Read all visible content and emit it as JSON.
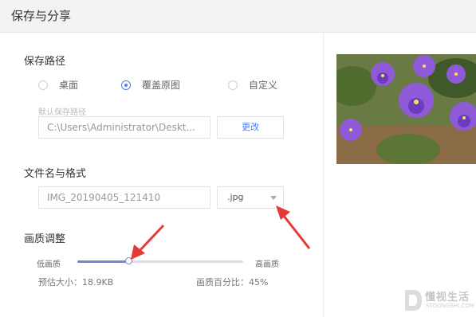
{
  "dialog": {
    "title": "保存与分享"
  },
  "save_path": {
    "section_title": "保存路径",
    "options": [
      {
        "label": "桌面",
        "checked": false
      },
      {
        "label": "覆盖原图",
        "checked": true
      },
      {
        "label": "自定义",
        "checked": false
      }
    ],
    "hint": "默认保存路径",
    "path_value": "C:\\Users\\Administrator\\Deskt...",
    "change_button": "更改"
  },
  "filename": {
    "section_title": "文件名与格式",
    "value": "IMG_20190405_121410",
    "format": ".jpg"
  },
  "quality": {
    "section_title": "画质调整",
    "low_label": "低画质",
    "high_label": "高画质",
    "level_percent": 45,
    "estimated_size": "预估大小：18.9KB",
    "percent_text": "画质百分比：45%"
  },
  "watermark": {
    "brand": "懂视生活",
    "sub": "STOONGSHI.COM"
  },
  "colors": {
    "accent": "#4d7ee8",
    "annotation_arrow": "#e53935"
  }
}
